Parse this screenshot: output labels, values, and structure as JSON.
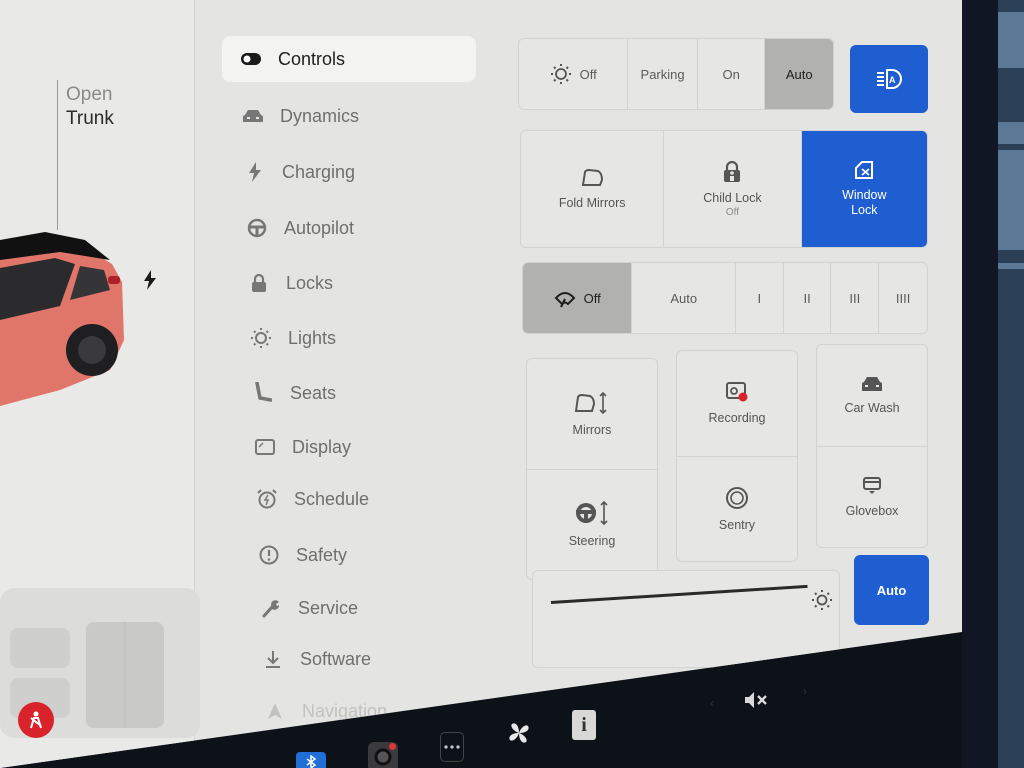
{
  "car_panel": {
    "trunk_label_line1": "Open",
    "trunk_label_line2": "Trunk",
    "car_color": "#e0756a",
    "seatbelt_warning_color": "#d8232a"
  },
  "nav": {
    "items": [
      {
        "label": "Controls",
        "icon": "toggle-icon",
        "active": true
      },
      {
        "label": "Dynamics",
        "icon": "car-icon"
      },
      {
        "label": "Charging",
        "icon": "lightning-icon"
      },
      {
        "label": "Autopilot",
        "icon": "steering-wheel-icon"
      },
      {
        "label": "Locks",
        "icon": "lock-icon"
      },
      {
        "label": "Lights",
        "icon": "light-bulb-icon"
      },
      {
        "label": "Seats",
        "icon": "seat-icon"
      },
      {
        "label": "Display",
        "icon": "display-icon"
      },
      {
        "label": "Schedule",
        "icon": "alarm-clock-icon"
      },
      {
        "label": "Safety",
        "icon": "alert-circle-icon"
      },
      {
        "label": "Service",
        "icon": "wrench-icon"
      },
      {
        "label": "Software",
        "icon": "download-icon"
      },
      {
        "label": "Navigation",
        "icon": "navigation-arrow-icon"
      }
    ]
  },
  "headlights": {
    "options": [
      "Off",
      "Parking",
      "On",
      "Auto"
    ],
    "selected": "Auto",
    "auto_high_beam_icon": "auto-high-beam-icon"
  },
  "quick_toggles": {
    "fold_mirrors": "Fold Mirrors",
    "child_lock": "Child Lock",
    "child_lock_state": "Off",
    "window_lock_line1": "Window",
    "window_lock_line2": "Lock",
    "window_lock_active": true
  },
  "wipers": {
    "options": [
      "Off",
      "Auto",
      "I",
      "II",
      "III",
      "IIII"
    ],
    "selected": "Off"
  },
  "tiles": {
    "mirrors": "Mirrors",
    "steering": "Steering",
    "recording": "Recording",
    "sentry": "Sentry",
    "car_wash": "Car Wash",
    "glovebox": "Glovebox"
  },
  "brightness": {
    "auto_label": "Auto",
    "level": 0.95
  },
  "accent_color": "#1e5ed0",
  "taskbar": {
    "volume_state": "muted"
  }
}
